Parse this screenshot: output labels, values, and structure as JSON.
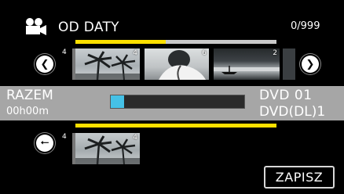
{
  "header": {
    "icon": "movie-camera-icon",
    "title": "OD DATY",
    "count": "0/999",
    "scroll_progress": 0.45
  },
  "nav": {
    "prev_icon": "chevron-left-icon",
    "next_icon": "chevron-right-icon",
    "back_icon": "arrow-left-icon"
  },
  "scenes": [
    {
      "number": "4",
      "stack_marker": "4"
    },
    {
      "number": "6"
    },
    {
      "number": "2"
    },
    {
      "number": ""
    }
  ],
  "selected": [
    {
      "number": "4",
      "stack_marker": "4"
    }
  ],
  "summary": {
    "total_label": "RAZEM",
    "total_time": "00h00m",
    "capacity_fraction": 0.1,
    "disc_line1": "DVD  01",
    "disc_line2": "DVD(DL)1"
  },
  "actions": {
    "save_label": "ZAPISZ"
  },
  "colors": {
    "accent": "#ffe000",
    "capacity": "#45c1e6",
    "band": "#a6a6a6"
  }
}
